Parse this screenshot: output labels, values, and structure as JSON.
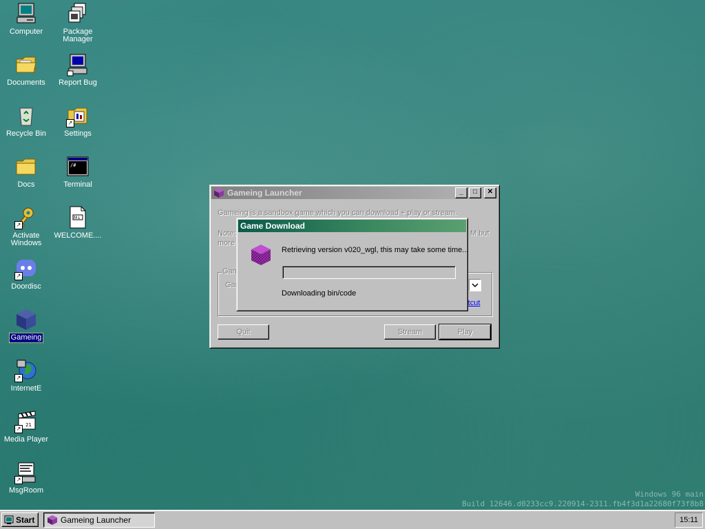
{
  "desktop": {
    "icons": [
      {
        "label": "Computer",
        "icon": "computer-icon"
      },
      {
        "label": "Package\nManager",
        "icon": "package-manager-icon"
      },
      {
        "label": "Documents",
        "icon": "documents-folder-icon"
      },
      {
        "label": "Report Bug",
        "icon": "report-bug-icon"
      },
      {
        "label": "Recycle Bin",
        "icon": "recycle-bin-icon"
      },
      {
        "label": "Settings",
        "icon": "settings-icon"
      },
      {
        "label": "Docs",
        "icon": "docs-folder-icon"
      },
      {
        "label": "Terminal",
        "icon": "terminal-icon"
      },
      {
        "label": "Activate\nWindows",
        "icon": "activate-windows-icon"
      },
      {
        "label": "WELCOME....",
        "icon": "welcome-file-icon"
      },
      {
        "label": "Doordisc",
        "icon": "doordisc-icon"
      },
      {
        "label": "Gameing",
        "icon": "gameing-icon"
      },
      {
        "label": "InternetE",
        "icon": "internet-explorer-icon"
      },
      {
        "label": "Media Player",
        "icon": "media-player-icon"
      },
      {
        "label": "MsgRoom",
        "icon": "msgroom-icon"
      }
    ],
    "build_line1": "Windows 96 main",
    "build_line2": "Build 12646.d0233cc9.220914-2311.fb4f3d1a22680f73f8b8"
  },
  "launcher": {
    "title": "Gameing Launcher",
    "description": "Gameing is a sandbox game which you can download + play or stream.",
    "note_start": "Note:",
    "note_end": "M but",
    "more": "more",
    "group_label": "Gam",
    "group_field_label": "Gar",
    "shortcut_link": "rtcut",
    "quit_label": "Quit",
    "stream_label": "Stream",
    "play_label": "Play"
  },
  "download": {
    "title": "Game Download",
    "message": "Retrieving version v020_wgl, this may take some time...",
    "status": "Downloading bin/code",
    "progress": 0
  },
  "taskbar": {
    "start_label": "Start",
    "task_label": "Gameing Launcher",
    "clock": "15:11"
  },
  "colors": {
    "desktop": "#2f7f7a",
    "active_title": "#0a5a4a",
    "selection": "#000080"
  }
}
